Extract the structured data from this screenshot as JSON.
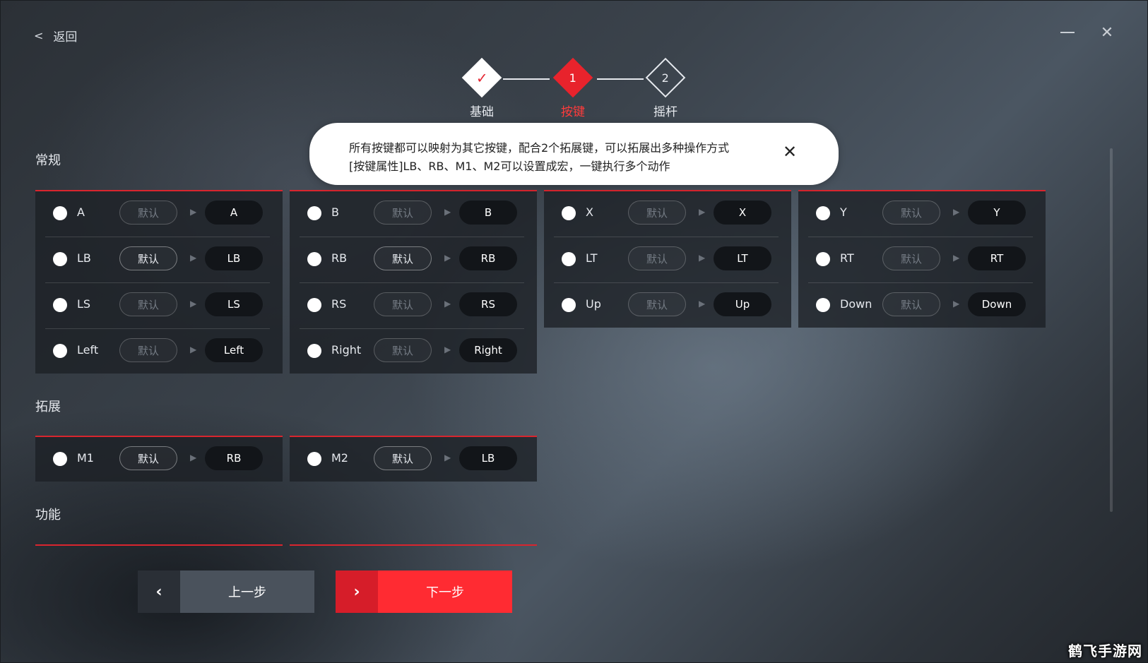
{
  "nav": {
    "back_label": "返回"
  },
  "stepper": {
    "steps": [
      {
        "label": "基础",
        "mark": "✓",
        "state": "done"
      },
      {
        "label": "按键",
        "mark": "1",
        "state": "active"
      },
      {
        "label": "摇杆",
        "mark": "2",
        "state": "todo"
      }
    ]
  },
  "tooltip": {
    "line1": "所有按键都可以映射为其它按键，配合2个拓展键，可以拓展出多种操作方式",
    "line2": "[按键属性]LB、RB、M1、M2可以设置成宏，一键执行多个动作"
  },
  "sections": {
    "general_title": "常规",
    "extend_title": "拓展",
    "function_title": "功能"
  },
  "general": {
    "columns": [
      [
        {
          "key": "A",
          "default_label": "默认",
          "default_active": false,
          "mapped": "A"
        },
        {
          "key": "LB",
          "default_label": "默认",
          "default_active": true,
          "mapped": "LB"
        },
        {
          "key": "LS",
          "default_label": "默认",
          "default_active": false,
          "mapped": "LS"
        },
        {
          "key": "Left",
          "default_label": "默认",
          "default_active": false,
          "mapped": "Left"
        }
      ],
      [
        {
          "key": "B",
          "default_label": "默认",
          "default_active": false,
          "mapped": "B"
        },
        {
          "key": "RB",
          "default_label": "默认",
          "default_active": true,
          "mapped": "RB"
        },
        {
          "key": "RS",
          "default_label": "默认",
          "default_active": false,
          "mapped": "RS"
        },
        {
          "key": "Right",
          "default_label": "默认",
          "default_active": false,
          "mapped": "Right"
        }
      ],
      [
        {
          "key": "X",
          "default_label": "默认",
          "default_active": false,
          "mapped": "X"
        },
        {
          "key": "LT",
          "default_label": "默认",
          "default_active": false,
          "mapped": "LT"
        },
        {
          "key": "Up",
          "default_label": "默认",
          "default_active": false,
          "mapped": "Up"
        }
      ],
      [
        {
          "key": "Y",
          "default_label": "默认",
          "default_active": false,
          "mapped": "Y"
        },
        {
          "key": "RT",
          "default_label": "默认",
          "default_active": false,
          "mapped": "RT"
        },
        {
          "key": "Down",
          "default_label": "默认",
          "default_active": false,
          "mapped": "Down"
        }
      ]
    ]
  },
  "extend": {
    "columns": [
      [
        {
          "key": "M1",
          "default_label": "默认",
          "default_active": true,
          "mapped": "RB"
        }
      ],
      [
        {
          "key": "M2",
          "default_label": "默认",
          "default_active": true,
          "mapped": "LB"
        }
      ]
    ]
  },
  "buttons": {
    "prev_label": "上一步",
    "next_label": "下一步"
  },
  "watermark": "鹤飞手游网",
  "colors": {
    "accent": "#ff2b32",
    "panel": "#1c2025",
    "map_pill": "#121519"
  }
}
